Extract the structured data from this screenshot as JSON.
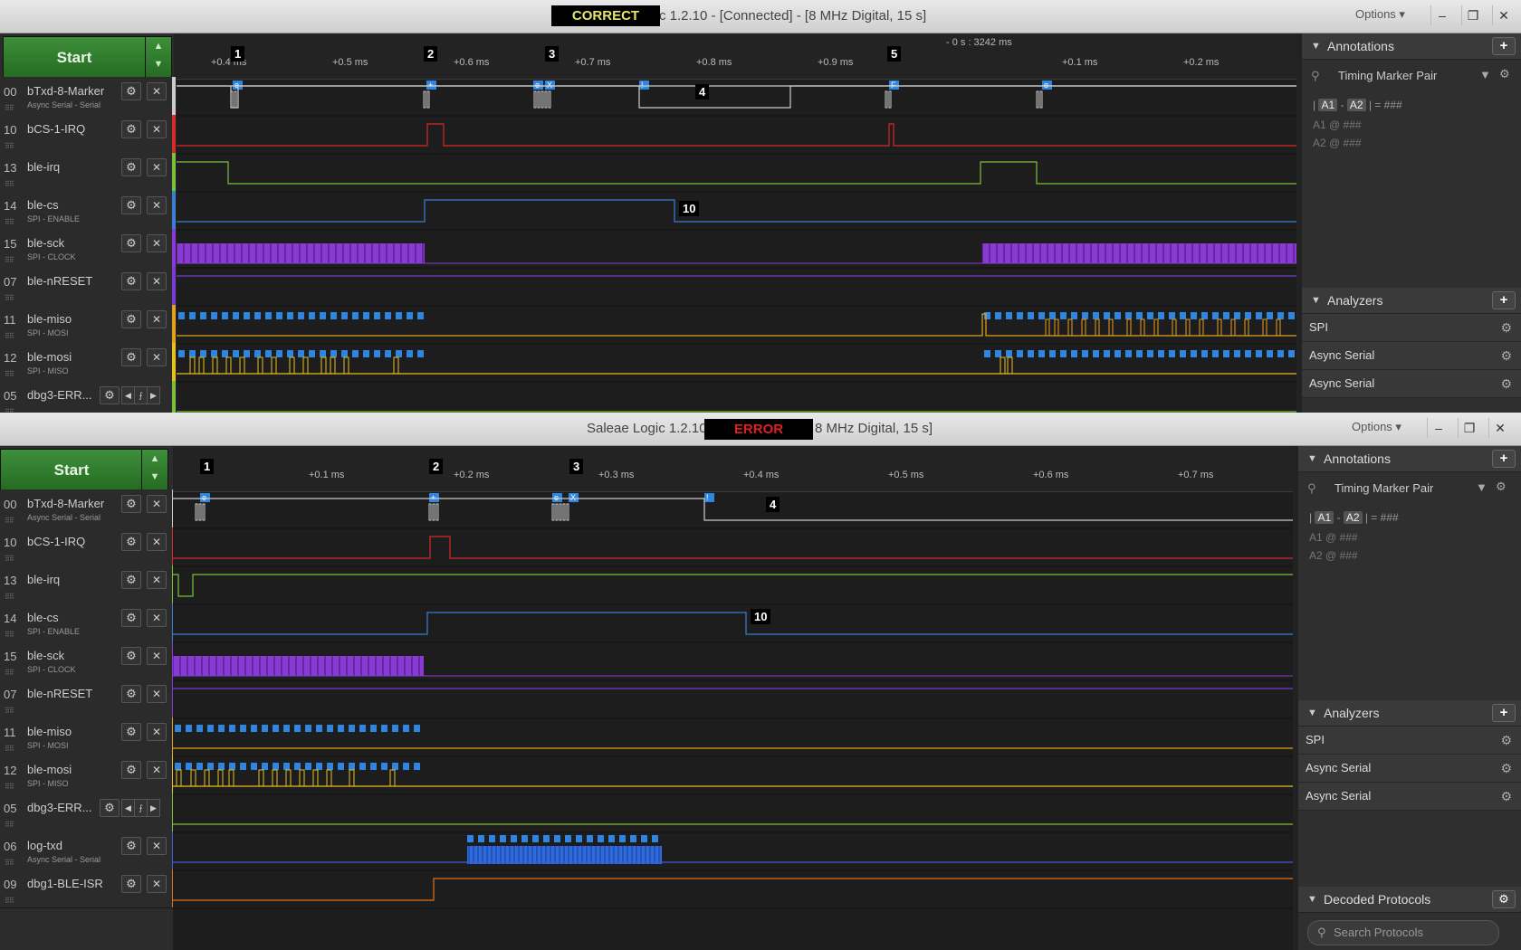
{
  "windows": [
    {
      "id": "correct",
      "title_text": "c 1.2.10 - [Connected] - [8 MHz Digital, 15 s]",
      "tag": "CORRECT",
      "tag_color": "#e6e66a",
      "options_label": "Options ▾",
      "start_label": "Start",
      "time_ref": "- 0 s : 3242 ms",
      "ticks": [
        "+0.4 ms",
        "+0.5 ms",
        "+0.6 ms",
        "+0.7 ms",
        "+0.8 ms",
        "+0.9 ms",
        "+0.1 ms",
        "+0.2 ms"
      ],
      "markers": [
        "1",
        "2",
        "3",
        "4",
        "5",
        "10"
      ],
      "channels": [
        {
          "num": "00",
          "name": "bTxd-8-Marker",
          "sub": "Async Serial - Serial",
          "color": "#cccccc"
        },
        {
          "num": "10",
          "name": "bCS-1-IRQ",
          "sub": "",
          "color": "#d42a2a"
        },
        {
          "num": "13",
          "name": "ble-irq",
          "sub": "",
          "color": "#7cbf3a"
        },
        {
          "num": "14",
          "name": "ble-cs",
          "sub": "SPI - ENABLE",
          "color": "#3a7fd4"
        },
        {
          "num": "15",
          "name": "ble-sck",
          "sub": "SPI - CLOCK",
          "color": "#8a3ad4"
        },
        {
          "num": "07",
          "name": "ble-nRESET",
          "sub": "",
          "color": "#7a3ad4"
        },
        {
          "num": "11",
          "name": "ble-miso",
          "sub": "SPI - MOSI",
          "color": "#e6a020"
        },
        {
          "num": "12",
          "name": "ble-mosi",
          "sub": "SPI - MISO",
          "color": "#e6c020"
        },
        {
          "num": "05",
          "name": "dbg3-ERR...",
          "sub": "",
          "color": "#7cbf3a"
        }
      ],
      "annotations_title": "Annotations",
      "timing_pair": "Timing Marker Pair",
      "anno_formula_a1": "A1",
      "anno_formula_a2": "A2",
      "anno_formula_value": "= ###",
      "anno_a1_line": "A1  @  ###",
      "anno_a2_line": "A2  @  ###",
      "analyzers_title": "Analyzers",
      "analyzers": [
        "SPI",
        "Async Serial",
        "Async Serial"
      ]
    },
    {
      "id": "error",
      "title_text": "Saleae Logic 1.2.10",
      "title_suffix": "8 MHz Digital, 15 s]",
      "tag": "ERROR",
      "tag_color": "#e02020",
      "options_label": "Options ▾",
      "start_label": "Start",
      "ticks": [
        "+0.1 ms",
        "+0.2 ms",
        "+0.3 ms",
        "+0.4 ms",
        "+0.5 ms",
        "+0.6 ms",
        "+0.7 ms"
      ],
      "markers": [
        "1",
        "2",
        "3",
        "4",
        "10"
      ],
      "channels": [
        {
          "num": "00",
          "name": "bTxd-8-Marker",
          "sub": "Async Serial - Serial",
          "color": "#cccccc"
        },
        {
          "num": "10",
          "name": "bCS-1-IRQ",
          "sub": "",
          "color": "#d42a2a"
        },
        {
          "num": "13",
          "name": "ble-irq",
          "sub": "",
          "color": "#7cbf3a"
        },
        {
          "num": "14",
          "name": "ble-cs",
          "sub": "SPI - ENABLE",
          "color": "#3a7fd4"
        },
        {
          "num": "15",
          "name": "ble-sck",
          "sub": "SPI - CLOCK",
          "color": "#8a3ad4"
        },
        {
          "num": "07",
          "name": "ble-nRESET",
          "sub": "",
          "color": "#7a3ad4"
        },
        {
          "num": "11",
          "name": "ble-miso",
          "sub": "SPI - MOSI",
          "color": "#e6a020"
        },
        {
          "num": "12",
          "name": "ble-mosi",
          "sub": "SPI - MISO",
          "color": "#e6c020"
        },
        {
          "num": "05",
          "name": "dbg3-ERR...",
          "sub": "",
          "color": "#7cbf3a"
        },
        {
          "num": "06",
          "name": "log-txd",
          "sub": "Async Serial - Serial",
          "color": "#3a5fd4"
        },
        {
          "num": "09",
          "name": "dbg1-BLE-ISR",
          "sub": "",
          "color": "#e0701a"
        }
      ],
      "annotations_title": "Annotations",
      "timing_pair": "Timing Marker Pair",
      "anno_formula_a1": "A1",
      "anno_formula_a2": "A2",
      "anno_formula_value": "= ###",
      "anno_a1_line": "A1  @  ###",
      "anno_a2_line": "A2  @  ###",
      "analyzers_title": "Analyzers",
      "analyzers": [
        "SPI",
        "Async Serial",
        "Async Serial"
      ],
      "decoded_title": "Decoded Protocols",
      "search_placeholder": "Search Protocols"
    }
  ],
  "bubble_labels": {
    "correct": [
      "e",
      "+",
      "e",
      "X",
      "!",
      "F",
      "e"
    ],
    "error": [
      "e",
      "+",
      "e",
      "X",
      "!"
    ]
  }
}
